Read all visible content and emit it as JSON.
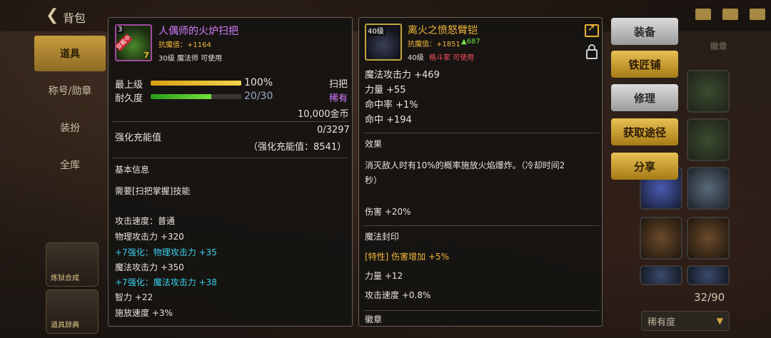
{
  "topbar": {
    "title": "背包"
  },
  "left_nav": [
    {
      "label": "道具"
    },
    {
      "label": "称号/勋章"
    },
    {
      "label": "装扮"
    },
    {
      "label": "全库"
    }
  ],
  "left_buttons": [
    {
      "label": "炼狱合成"
    },
    {
      "label": "道具辞典"
    }
  ],
  "right_tabs": [
    "",
    "",
    "徽章"
  ],
  "right_count": "32/90",
  "sort_label": "稀有度",
  "item1": {
    "icon_level": "3",
    "icon_badge": "穿戴中",
    "name": "人偶师的火炉扫把",
    "power_label": "抗魔值：+1164",
    "requirement": "30级 魔法师 可使用",
    "rows": {
      "grade_label": "最上级",
      "grade_pct": "100%",
      "grade_fill": 1.0,
      "type": "扫把",
      "durability_label": "耐久度",
      "durability_value": "20/30",
      "durability_fill": 0.6667,
      "rarity": "稀有",
      "price": "10,000金币"
    },
    "charge": {
      "label": "强化充能值",
      "value": "0/3297",
      "detail": "（强化充能值：8541）"
    },
    "basic_header": "基本信息",
    "need_skill": "需要[扫把掌握]技能",
    "stats": [
      {
        "text": "攻击速度：普通",
        "color": "white"
      },
      {
        "text": "物理攻击力 +320",
        "color": "white"
      },
      {
        "text": "+7强化：物理攻击力 +35",
        "color": "cyan"
      },
      {
        "text": "魔法攻击力 +350",
        "color": "white"
      },
      {
        "text": "+7强化：魔法攻击力 +38",
        "color": "cyan"
      },
      {
        "text": "智力 +22",
        "color": "white"
      },
      {
        "text": "施放速度 +3%",
        "color": "white"
      }
    ]
  },
  "item2": {
    "icon_level": "40级",
    "name": "离火之愤怒臂铠",
    "power_label": "抗魔值：+1851",
    "power_up": "▲687",
    "requirement_level": "40级",
    "requirement_class": "格斗家 可使用",
    "stats": [
      "魔法攻击力 +469",
      "力量 +55",
      "命中率 +1%",
      "命中 +194"
    ],
    "effect_header": "效果",
    "effect_text_1": "消灭敌人时有10%的概率施放火焰爆炸。（冷却时间2",
    "effect_text_2": "秒）",
    "damage": "伤害 +20%",
    "seal_header": "魔法封印",
    "seal_trait": "[特性] 伤害增加 +5%",
    "seal_stats": [
      "力量 +12",
      "攻击速度 +0.8%"
    ],
    "bottom_cut": "徽章"
  },
  "actions": [
    {
      "label": "装备",
      "style": "gray"
    },
    {
      "label": "铁匠铺",
      "style": "gold"
    },
    {
      "label": "修理",
      "style": "gray"
    },
    {
      "label": "获取途径",
      "style": "gold"
    },
    {
      "label": "分享",
      "style": "gold"
    }
  ],
  "colors": {
    "purple": "#d57dff",
    "gold": "#f0b73a",
    "cyan": "#3ad0f0",
    "red": "#ff4f5c",
    "green": "#6fe24a"
  }
}
